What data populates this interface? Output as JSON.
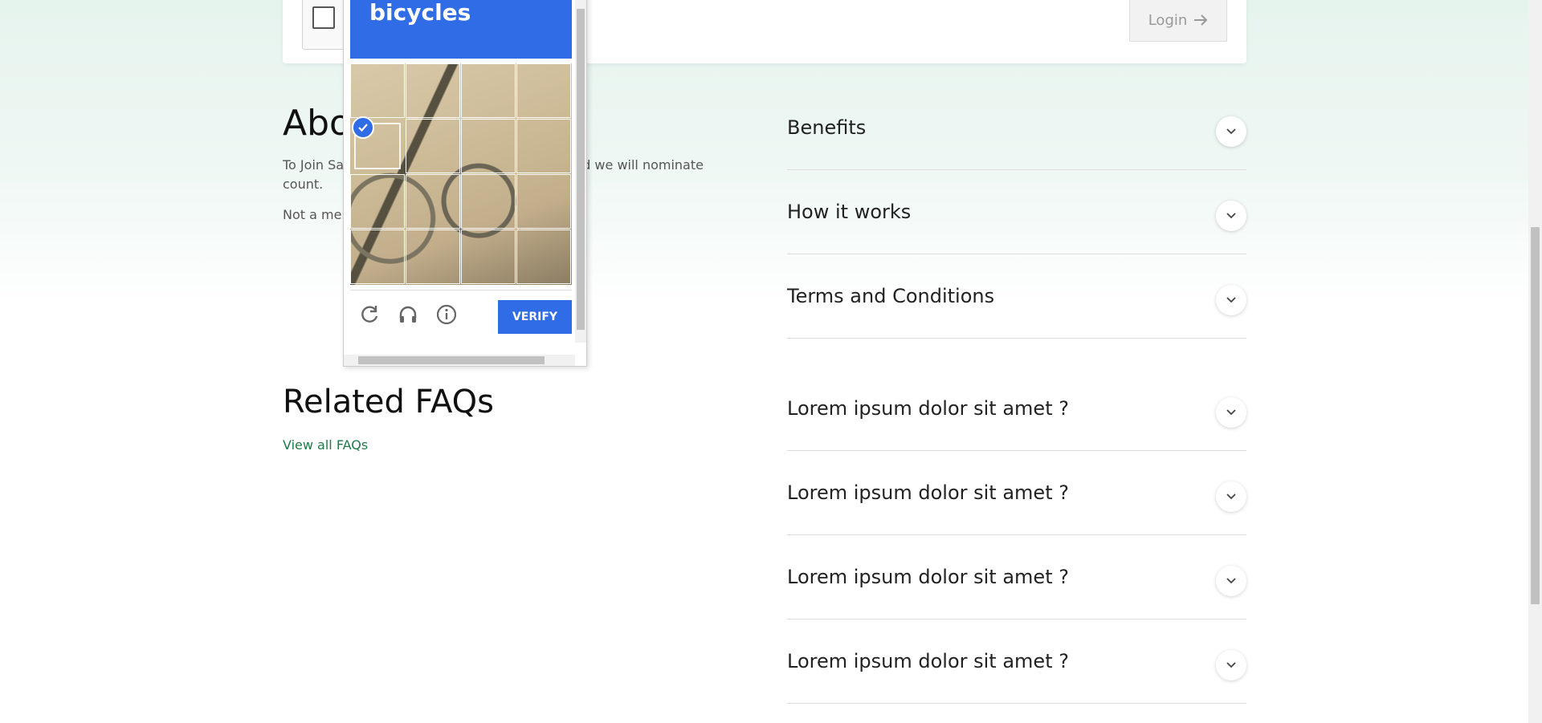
{
  "login": {
    "button_label": "Login"
  },
  "about": {
    "title": "Abo",
    "text": "To Join Sa                                        ent form and we will nominate                                        count.",
    "note": "Not a mer"
  },
  "captcha": {
    "target_word": "bicycles",
    "verify_label": "VERIFY"
  },
  "faqs": {
    "title": "Related FAQs",
    "view_all_label": "View all FAQs"
  },
  "accordion_top": [
    {
      "label": "Benefits"
    },
    {
      "label": "How it works"
    },
    {
      "label": "Terms and Conditions"
    }
  ],
  "accordion_faq": [
    {
      "label": "Lorem ipsum dolor sit amet ?"
    },
    {
      "label": "Lorem ipsum dolor sit amet ?"
    },
    {
      "label": "Lorem ipsum dolor sit amet ?"
    },
    {
      "label": "Lorem ipsum dolor sit amet ?"
    }
  ],
  "colors": {
    "accent": "#2f6ce5",
    "link": "#1f7a4a"
  }
}
